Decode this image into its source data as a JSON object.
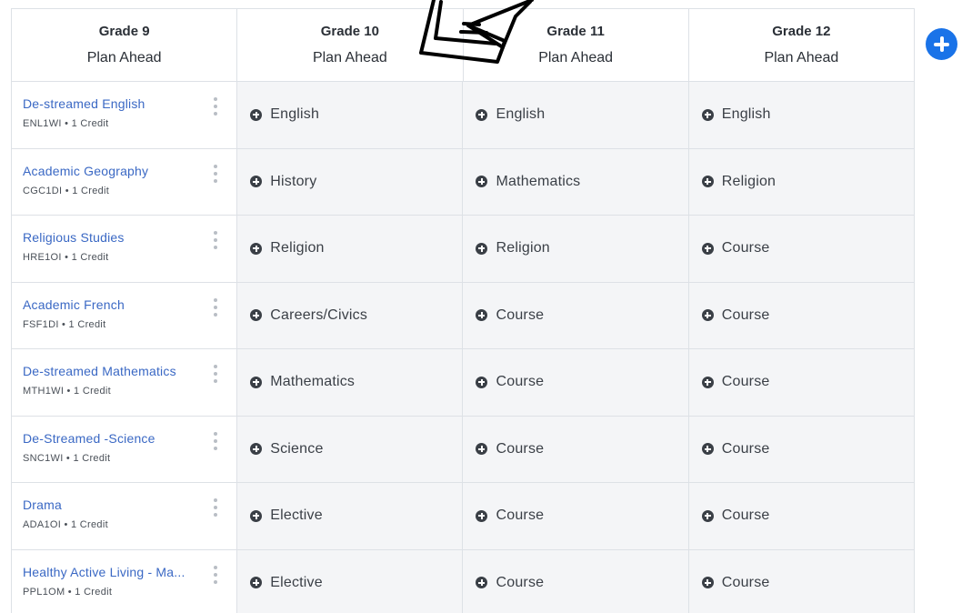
{
  "headers": [
    {
      "grade": "Grade 9",
      "plan": "Plan Ahead"
    },
    {
      "grade": "Grade 10",
      "plan": "Plan Ahead"
    },
    {
      "grade": "Grade 11",
      "plan": "Plan Ahead"
    },
    {
      "grade": "Grade 12",
      "plan": "Plan Ahead"
    }
  ],
  "grade9_courses": [
    {
      "name": "De-streamed English",
      "meta": "ENL1WI • 1 Credit"
    },
    {
      "name": "Academic Geography",
      "meta": "CGC1DI • 1 Credit"
    },
    {
      "name": "Religious Studies",
      "meta": "HRE1OI • 1 Credit"
    },
    {
      "name": "Academic French",
      "meta": "FSF1DI • 1 Credit"
    },
    {
      "name": "De-streamed Mathematics",
      "meta": "MTH1WI • 1 Credit"
    },
    {
      "name": "De-Streamed -Science",
      "meta": "SNC1WI • 1 Credit"
    },
    {
      "name": "Drama",
      "meta": "ADA1OI • 1 Credit"
    },
    {
      "name": "Healthy Active Living - Ma...",
      "meta": "PPL1OM • 1 Credit"
    }
  ],
  "grade10_slots": [
    "English",
    "History",
    "Religion",
    "Careers/Civics",
    "Mathematics",
    "Science",
    "Elective",
    "Elective"
  ],
  "grade11_slots": [
    "English",
    "Mathematics",
    "Religion",
    "Course",
    "Course",
    "Course",
    "Course",
    "Course"
  ],
  "grade12_slots": [
    "English",
    "Religion",
    "Course",
    "Course",
    "Course",
    "Course",
    "Course",
    "Course"
  ],
  "icons": {
    "course_menu": "kebab-menu-icon",
    "slot_add": "plus-circle-icon",
    "add_year": "plus-circle-icon"
  },
  "colors": {
    "link": "#3a68c4",
    "accent": "#1a73e8",
    "slot_bg": "#f4f5f7"
  }
}
